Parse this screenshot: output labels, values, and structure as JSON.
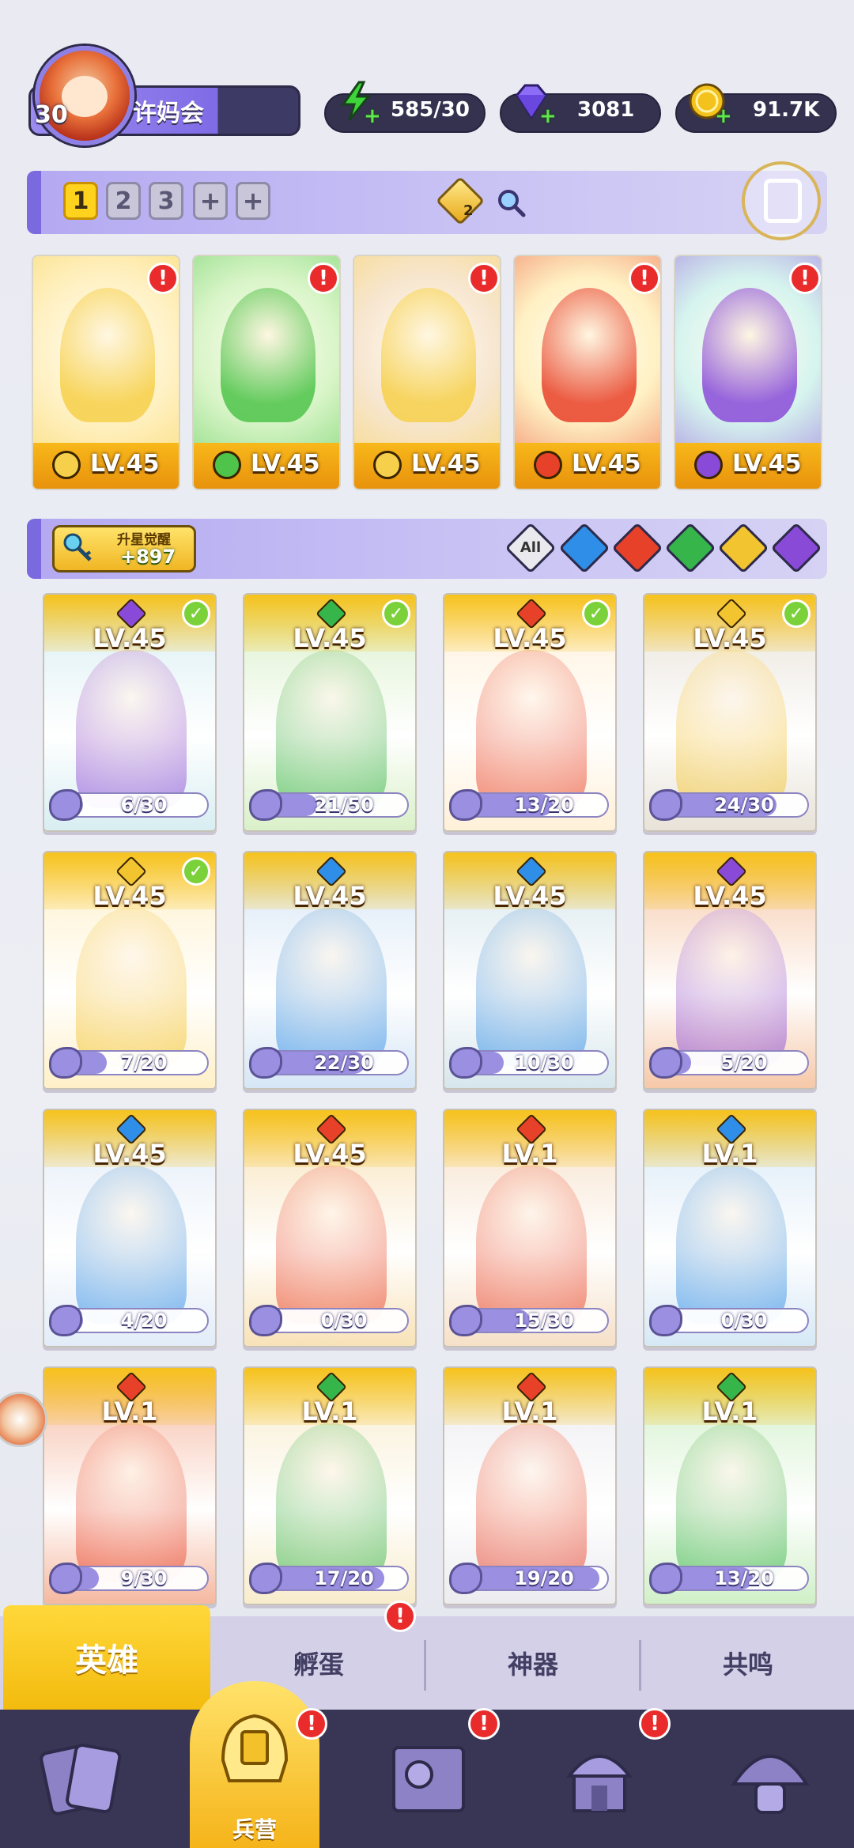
{
  "profile": {
    "name": "许妈会",
    "level": "30"
  },
  "resources": {
    "energy": "585/30",
    "gems": "3081",
    "coins": "91.7K",
    "colors": {
      "energy": "#3fd43a",
      "gems": "#7d5cf0",
      "coins": "#f4c21c"
    }
  },
  "team": {
    "tabs": [
      "1",
      "2",
      "3",
      "+",
      "+"
    ],
    "active_tab": "1",
    "diamond_count": "2",
    "slots": [
      {
        "level": "LV.45",
        "element": "light",
        "color": "#f6d04a",
        "alert": "!"
      },
      {
        "level": "LV.45",
        "element": "nature",
        "color": "#4ec44a",
        "alert": "!"
      },
      {
        "level": "LV.45",
        "element": "light",
        "color": "#f6d04a",
        "alert": "!"
      },
      {
        "level": "LV.45",
        "element": "fire",
        "color": "#e8412a",
        "alert": "!"
      },
      {
        "level": "LV.45",
        "element": "dark",
        "color": "#8a4ad8",
        "alert": "!"
      }
    ]
  },
  "filters": {
    "star_awaken_label": "升星觉醒",
    "star_awaken_count": "+897",
    "all_label": "All",
    "elements": [
      "water",
      "fire",
      "nature",
      "light",
      "dark"
    ]
  },
  "heroes": [
    {
      "level": "LV.45",
      "element": "dark",
      "checked": true,
      "progress": "6/30",
      "fraction": 0.2
    },
    {
      "level": "LV.45",
      "element": "nature",
      "checked": true,
      "progress": "21/50",
      "fraction": 0.42
    },
    {
      "level": "LV.45",
      "element": "fire",
      "checked": true,
      "progress": "13/20",
      "fraction": 0.65
    },
    {
      "level": "LV.45",
      "element": "light",
      "checked": true,
      "progress": "24/30",
      "fraction": 0.8
    },
    {
      "level": "LV.45",
      "element": "light",
      "checked": true,
      "progress": "7/20",
      "fraction": 0.35
    },
    {
      "level": "LV.45",
      "element": "water",
      "checked": false,
      "progress": "22/30",
      "fraction": 0.73
    },
    {
      "level": "LV.45",
      "element": "water",
      "checked": false,
      "progress": "10/30",
      "fraction": 0.33
    },
    {
      "level": "LV.45",
      "element": "dark",
      "checked": false,
      "progress": "5/20",
      "fraction": 0.25
    },
    {
      "level": "LV.45",
      "element": "water",
      "checked": false,
      "progress": "4/20",
      "fraction": 0.2
    },
    {
      "level": "LV.45",
      "element": "fire",
      "checked": false,
      "progress": "0/30",
      "fraction": 0.0
    },
    {
      "level": "LV.1",
      "element": "fire",
      "checked": false,
      "progress": "15/30",
      "fraction": 0.5
    },
    {
      "level": "LV.1",
      "element": "water",
      "checked": false,
      "progress": "0/30",
      "fraction": 0.0
    },
    {
      "level": "LV.1",
      "element": "fire",
      "checked": false,
      "progress": "9/30",
      "fraction": 0.3
    },
    {
      "level": "LV.1",
      "element": "nature",
      "checked": false,
      "progress": "17/20",
      "fraction": 0.85
    },
    {
      "level": "LV.1",
      "element": "fire",
      "checked": false,
      "progress": "19/20",
      "fraction": 0.95
    },
    {
      "level": "LV.1",
      "element": "nature",
      "checked": false,
      "progress": "13/20",
      "fraction": 0.65
    }
  ],
  "element_colors": {
    "water": "#2f8ee8",
    "fire": "#e8412a",
    "nature": "#35b54a",
    "light": "#f2c430",
    "dark": "#8a4ad8"
  },
  "sub_tabs": [
    "英雄",
    "孵蛋",
    "神器",
    "共鸣"
  ],
  "sub_tab_alert": "!",
  "nav": {
    "active_label": "兵营",
    "items": [
      "cards-icon",
      "barracks-icon",
      "map-icon",
      "shrine-icon",
      "mushroom-icon"
    ],
    "alerts": [
      "!",
      "!",
      "!"
    ]
  }
}
